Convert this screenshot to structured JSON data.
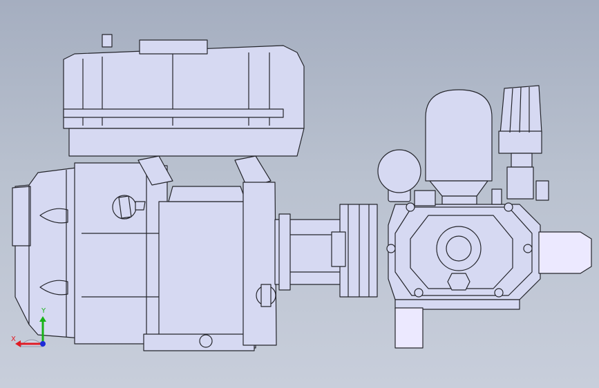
{
  "viewport": {
    "background_top": "#a5aec0",
    "background_bottom": "#c8cedb",
    "model_fill": "#d6d9f2",
    "model_line": "#24252b",
    "model_accent": "#ece9ff"
  },
  "triad": {
    "x_label": "X",
    "y_label": "Y",
    "x_color": "#e01b24",
    "y_color": "#18b318",
    "z_color": "#1d2bd8"
  }
}
